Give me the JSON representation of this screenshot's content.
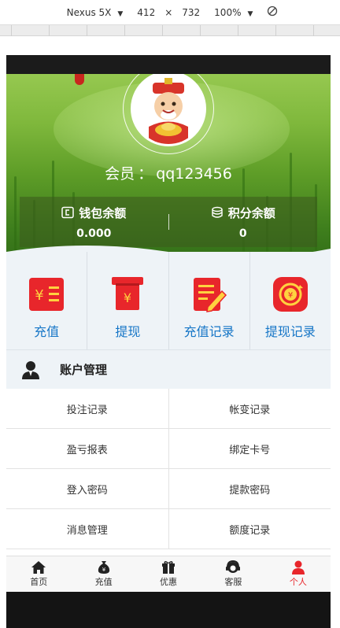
{
  "devtools": {
    "device": "Nexus 5X",
    "width": "412",
    "times": "×",
    "height": "732",
    "zoom": "100%"
  },
  "profile": {
    "member_label": "会员",
    "member_sep": "：",
    "username": "qq123456"
  },
  "balances": [
    {
      "label": "钱包余额",
      "value": "0.000",
      "icon": "wallet-icon"
    },
    {
      "label": "积分余额",
      "value": "0",
      "icon": "coins-icon"
    }
  ],
  "actions": [
    {
      "label": "充值",
      "icon": "recharge-icon"
    },
    {
      "label": "提现",
      "icon": "withdraw-icon"
    },
    {
      "label": "充值记录",
      "icon": "recharge-record-icon"
    },
    {
      "label": "提现记录",
      "icon": "withdraw-record-icon"
    }
  ],
  "account": {
    "title": "账户管理",
    "items": [
      [
        "投注记录",
        "帐变记录"
      ],
      [
        "盈亏报表",
        "绑定卡号"
      ],
      [
        "登入密码",
        "提款密码"
      ],
      [
        "消息管理",
        "额度记录"
      ]
    ]
  },
  "tabbar": [
    {
      "label": "首页",
      "icon": "home-icon"
    },
    {
      "label": "充值",
      "icon": "money-bag-icon"
    },
    {
      "label": "优惠",
      "icon": "gift-icon"
    },
    {
      "label": "客服",
      "icon": "headset-icon"
    },
    {
      "label": "个人",
      "icon": "user-icon",
      "active": true
    }
  ],
  "colors": {
    "accent_blue": "#1676c7",
    "icon_red": "#e8262b",
    "active_tab": "#e8262b"
  }
}
